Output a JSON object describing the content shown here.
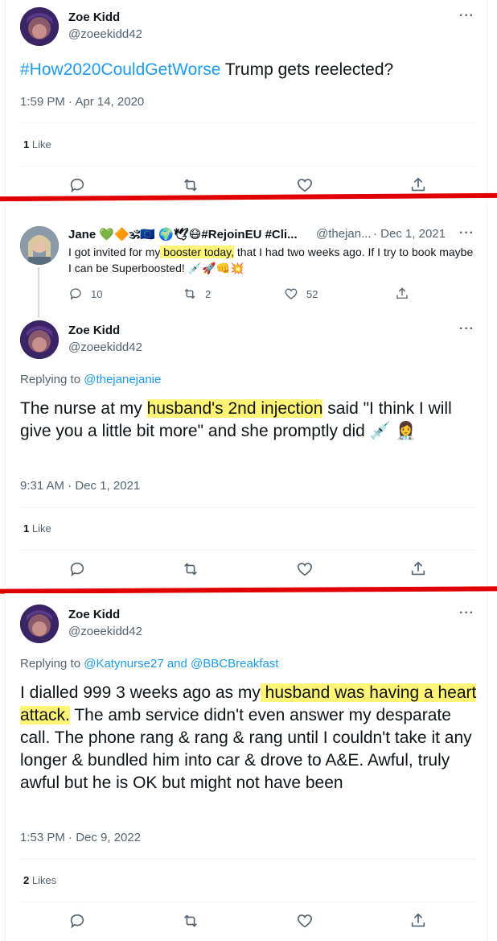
{
  "tweet1": {
    "name": "Zoe Kidd",
    "handle": "@zoeekidd42",
    "hashtag": "#How2020CouldGetWorse",
    "text_rest": " Trump gets reelected?",
    "time": "1:59 PM · Apr 14, 2020",
    "likes_count": "1",
    "likes_label": "Like"
  },
  "quoted": {
    "name": "Jane 💚🔶🕉🇪🇺 🌍🕊😷#RejoinEU #Cli...",
    "handle": "@thejan...",
    "date": "· Dec 1, 2021",
    "text_pre": "I got invited for my",
    "text_hl": " booster today,",
    "text_post": " that I had two weeks ago. If I try to book maybe I can be Superboosted! 💉🚀👊💥",
    "replies": "10",
    "retweets": "2",
    "likes": "52"
  },
  "tweet2": {
    "name": "Zoe Kidd",
    "handle": "@zoeekidd42",
    "replying_label": "Replying to ",
    "replying_to": "@thejanejanie",
    "text_pre": "The nurse at my ",
    "text_hl": "husband's 2nd injection",
    "text_post": " said \"I think I will give you a little bit more\" and she promptly did 💉 👩‍⚕️",
    "time": "9:31 AM · Dec 1, 2021",
    "likes_count": "1",
    "likes_label": "Like"
  },
  "tweet3": {
    "name": "Zoe Kidd",
    "handle": "@zoeekidd42",
    "replying_label": "Replying to ",
    "replying_to": "@Katynurse27 and @BBCBreakfast",
    "text_pre": "I dialled 999 3 weeks ago as my",
    "text_hl": " husband was having a heart attack.",
    "text_post": " The amb service didn't even answer my desparate call. The phone rang & rang & rang until I couldn't take it any longer & bundled him into car & drove to A&E. Awful, truly awful but he is OK but might not have been",
    "time": "1:53 PM · Dec 9, 2022",
    "likes_count": "2",
    "likes_label": "Likes"
  },
  "more_label": "···",
  "colors": {
    "accent": "#1d9bf0",
    "highlight": "#fff475",
    "separator": "#e00000",
    "muted": "#536471"
  },
  "icons": [
    "reply-icon",
    "retweet-icon",
    "like-icon",
    "share-icon"
  ]
}
